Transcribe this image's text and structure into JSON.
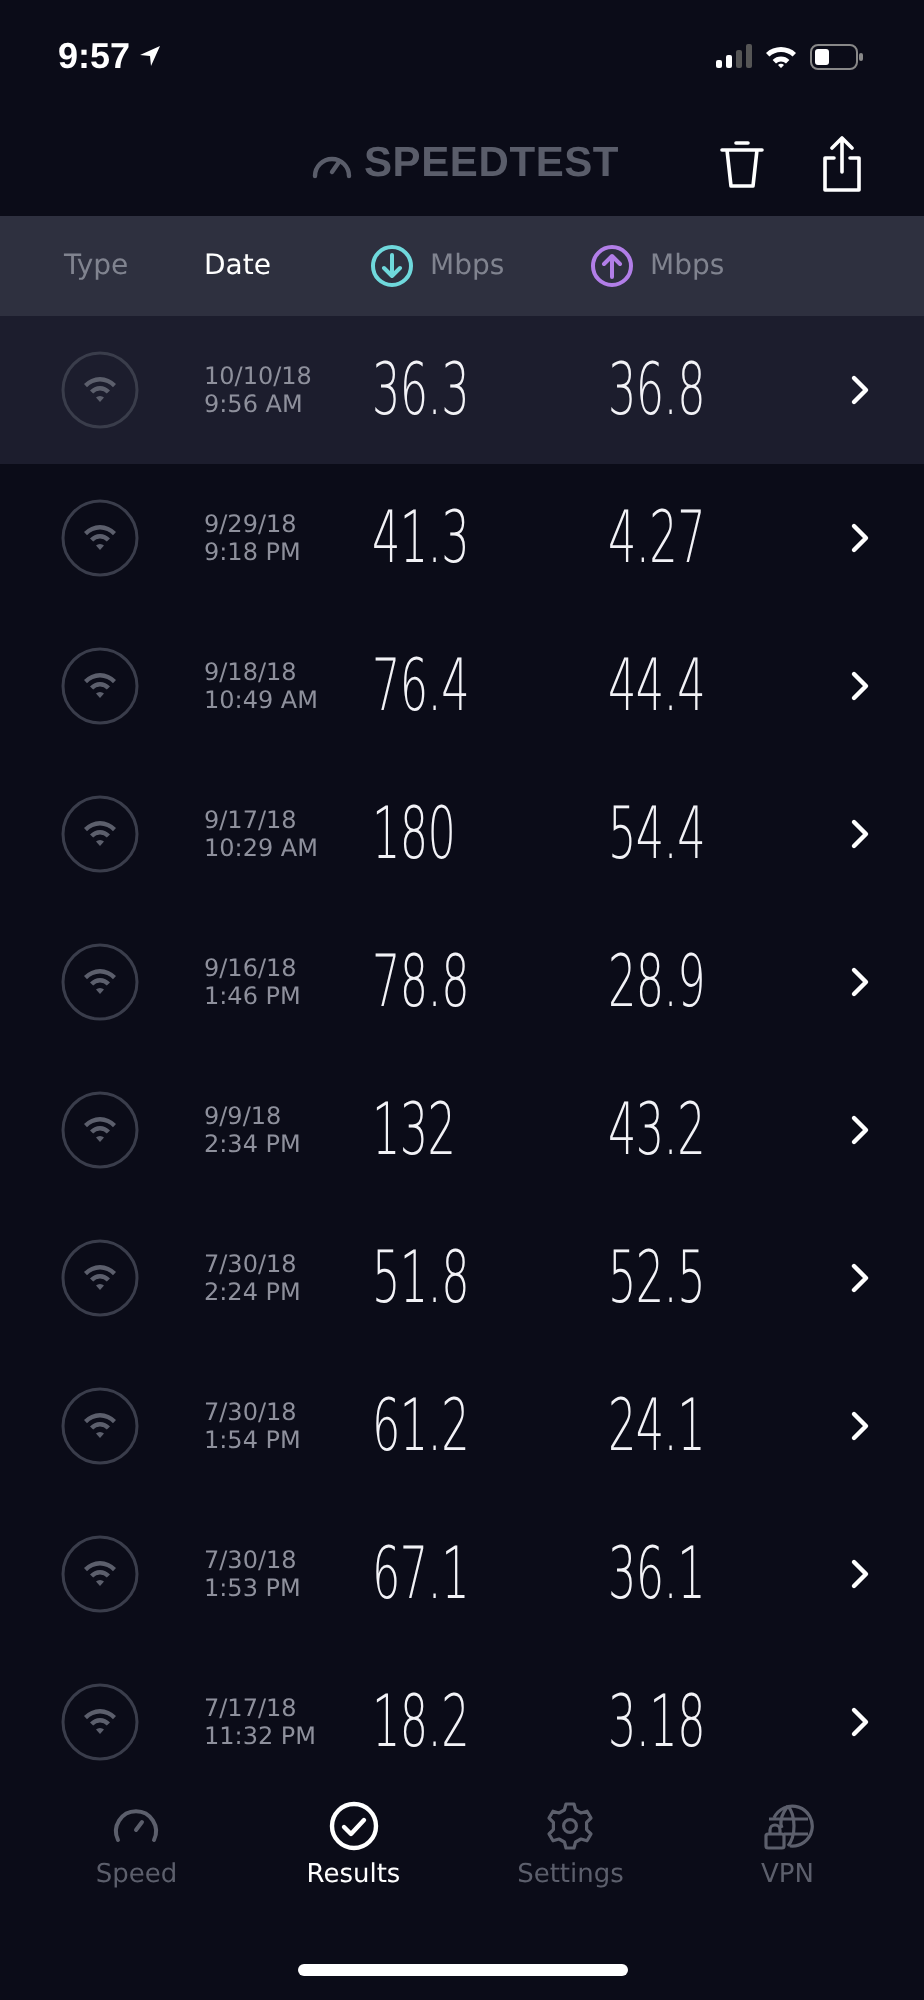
{
  "status_bar": {
    "time": "9:57"
  },
  "header": {
    "logo": "SPEEDTEST"
  },
  "columns": [
    {
      "label": "Type",
      "selected": false,
      "kind": "text"
    },
    {
      "label": "Date",
      "selected": true,
      "kind": "text"
    },
    {
      "label": "Mbps",
      "selected": false,
      "kind": "download"
    },
    {
      "label": "Mbps",
      "selected": false,
      "kind": "upload"
    }
  ],
  "rows": [
    {
      "date": "10/10/18",
      "time": "9:56 AM",
      "download": "36.3",
      "upload": "36.8",
      "selected": true
    },
    {
      "date": "9/29/18",
      "time": "9:18 PM",
      "download": "41.3",
      "upload": "4.27",
      "selected": false
    },
    {
      "date": "9/18/18",
      "time": "10:49 AM",
      "download": "76.4",
      "upload": "44.4",
      "selected": false
    },
    {
      "date": "9/17/18",
      "time": "10:29 AM",
      "download": "180",
      "upload": "54.4",
      "selected": false
    },
    {
      "date": "9/16/18",
      "time": "1:46 PM",
      "download": "78.8",
      "upload": "28.9",
      "selected": false
    },
    {
      "date": "9/9/18",
      "time": "2:34 PM",
      "download": "132",
      "upload": "43.2",
      "selected": false
    },
    {
      "date": "7/30/18",
      "time": "2:24 PM",
      "download": "51.8",
      "upload": "52.5",
      "selected": false
    },
    {
      "date": "7/30/18",
      "time": "1:54 PM",
      "download": "61.2",
      "upload": "24.1",
      "selected": false
    },
    {
      "date": "7/30/18",
      "time": "1:53 PM",
      "download": "67.1",
      "upload": "36.1",
      "selected": false
    },
    {
      "date": "7/17/18",
      "time": "11:32 PM",
      "download": "18.2",
      "upload": "3.18",
      "selected": false
    }
  ],
  "tabs": [
    {
      "label": "Speed",
      "selected": false,
      "kind": "speed"
    },
    {
      "label": "Results",
      "selected": true,
      "kind": "results"
    },
    {
      "label": "Settings",
      "selected": false,
      "kind": "settings"
    },
    {
      "label": "VPN",
      "selected": false,
      "kind": "vpn"
    }
  ]
}
